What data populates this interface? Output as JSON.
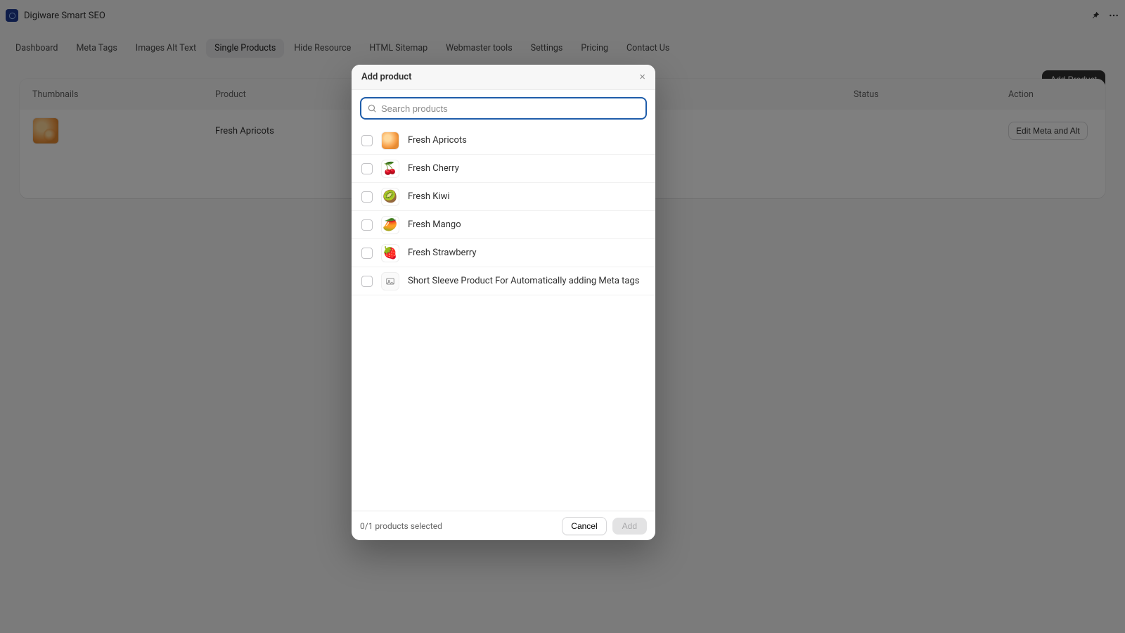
{
  "header": {
    "app_title": "Digiware Smart SEO"
  },
  "nav": {
    "items": [
      "Dashboard",
      "Meta Tags",
      "Images Alt Text",
      "Single Products",
      "Hide Resource",
      "HTML Sitemap",
      "Webmaster tools",
      "Settings",
      "Pricing",
      "Contact Us"
    ],
    "active_index": 3
  },
  "toolbar": {
    "add_product_label": "Add Product"
  },
  "table": {
    "columns": {
      "thumbnails": "Thumbnails",
      "product": "Product",
      "status": "Status",
      "action": "Action"
    },
    "rows": [
      {
        "product": "Fresh Apricots",
        "action_label": "Edit Meta and Alt"
      }
    ]
  },
  "modal": {
    "title": "Add product",
    "search_placeholder": "Search products",
    "selected_text": "0/1 products selected",
    "cancel_label": "Cancel",
    "add_label": "Add",
    "products": [
      {
        "name": "Fresh Apricots",
        "icon": "apricot",
        "emoji": ""
      },
      {
        "name": "Fresh Cherry",
        "icon": "cherry",
        "emoji": "🍒"
      },
      {
        "name": "Fresh Kiwi",
        "icon": "kiwi",
        "emoji": "🥝"
      },
      {
        "name": "Fresh Mango",
        "icon": "mango",
        "emoji": "🥭"
      },
      {
        "name": "Fresh Strawberry",
        "icon": "strawberry",
        "emoji": "🍓"
      },
      {
        "name": "Short Sleeve Product For Automatically adding Meta tags",
        "icon": "placeholder",
        "emoji": ""
      }
    ]
  }
}
